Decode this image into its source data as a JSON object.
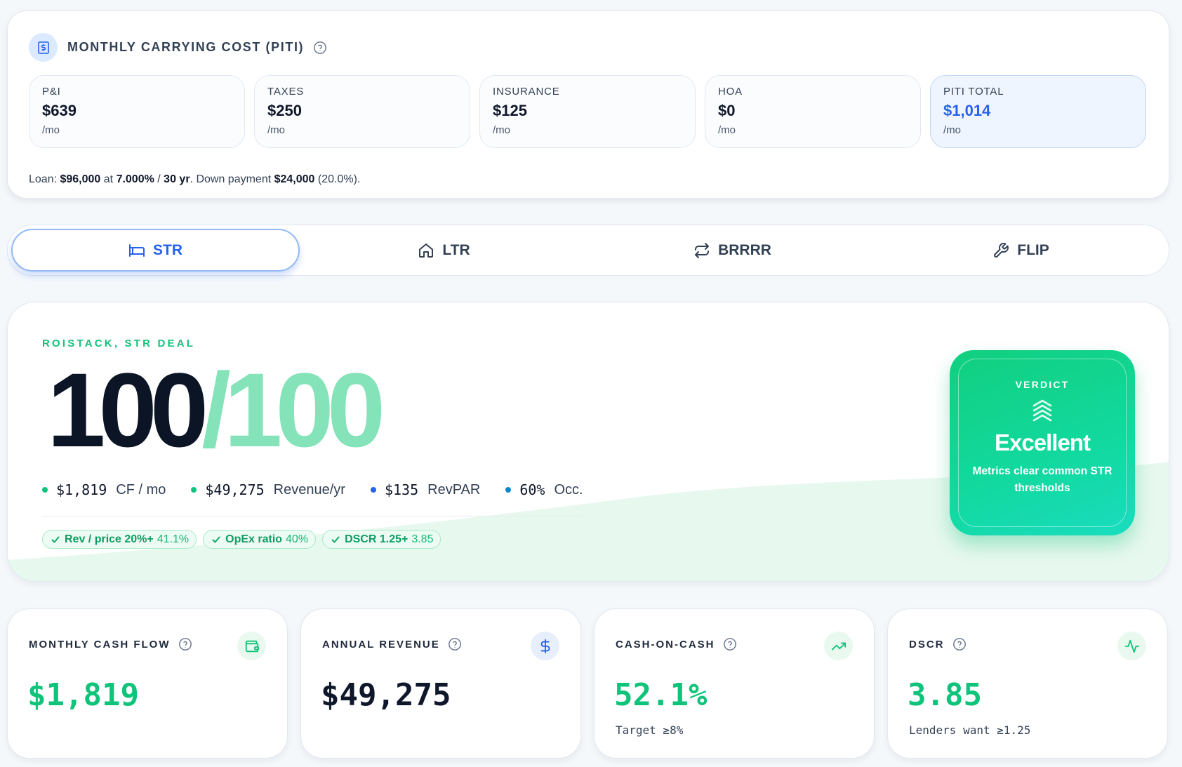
{
  "piti": {
    "title": "MONTHLY CARRYING COST (PITI)",
    "boxes": [
      {
        "label": "P&I",
        "value": "$639",
        "unit": "/mo"
      },
      {
        "label": "TAXES",
        "value": "$250",
        "unit": "/mo"
      },
      {
        "label": "INSURANCE",
        "value": "$125",
        "unit": "/mo"
      },
      {
        "label": "HOA",
        "value": "$0",
        "unit": "/mo"
      },
      {
        "label": "PITI TOTAL",
        "value": "$1,014",
        "unit": "/mo"
      }
    ],
    "loan": {
      "prefix": "Loan: ",
      "amount": "$96,000",
      "at": " at ",
      "rate": "7.000%",
      "sep": " / ",
      "term": "30 yr",
      "mid": ". Down payment ",
      "down": "$24,000",
      "pct": " (20.0%)."
    }
  },
  "tabs": [
    {
      "label": "STR",
      "icon": "bed-icon",
      "active": true
    },
    {
      "label": "LTR",
      "icon": "home-icon",
      "active": false
    },
    {
      "label": "BRRRR",
      "icon": "repeat-icon",
      "active": false
    },
    {
      "label": "FLIP",
      "icon": "wrench-icon",
      "active": false
    }
  ],
  "score": {
    "eyebrow": "ROISTACK, STR DEAL",
    "value": "100",
    "slash": "/",
    "max": "100",
    "stats": [
      {
        "value": "$1,819",
        "label": "CF / mo",
        "color": "#10c37a"
      },
      {
        "value": "$49,275",
        "label": "Revenue/yr",
        "color": "#10c37a"
      },
      {
        "value": "$135",
        "label": "RevPAR",
        "color": "#2563eb"
      },
      {
        "value": "60%",
        "label": "Occ.",
        "color": "#0e87d1"
      }
    ],
    "chips": [
      {
        "label": "Rev / price 20%+",
        "value": "41.1%"
      },
      {
        "label": "OpEx ratio",
        "value": "40%"
      },
      {
        "label": "DSCR 1.25+",
        "value": "3.85"
      }
    ],
    "verdict": {
      "label": "VERDICT",
      "value": "Excellent",
      "desc": "Metrics clear common STR thresholds"
    }
  },
  "metrics": [
    {
      "title": "MONTHLY CASH FLOW",
      "value": "$1,819",
      "sub": "",
      "icon": "wallet-icon",
      "tone": "green"
    },
    {
      "title": "ANNUAL REVENUE",
      "value": "$49,275",
      "sub": "",
      "icon": "dollar-icon",
      "tone": "dark"
    },
    {
      "title": "CASH-ON-CASH",
      "value": "52.1%",
      "sub": "Target ≥8%",
      "icon": "trending-up-icon",
      "tone": "green"
    },
    {
      "title": "DSCR",
      "value": "3.85",
      "sub": "Lenders want ≥1.25",
      "icon": "activity-icon",
      "tone": "green"
    }
  ],
  "colors": {
    "accent_blue": "#2563eb",
    "accent_green": "#10c37a",
    "score_light": "#84e3b8"
  }
}
